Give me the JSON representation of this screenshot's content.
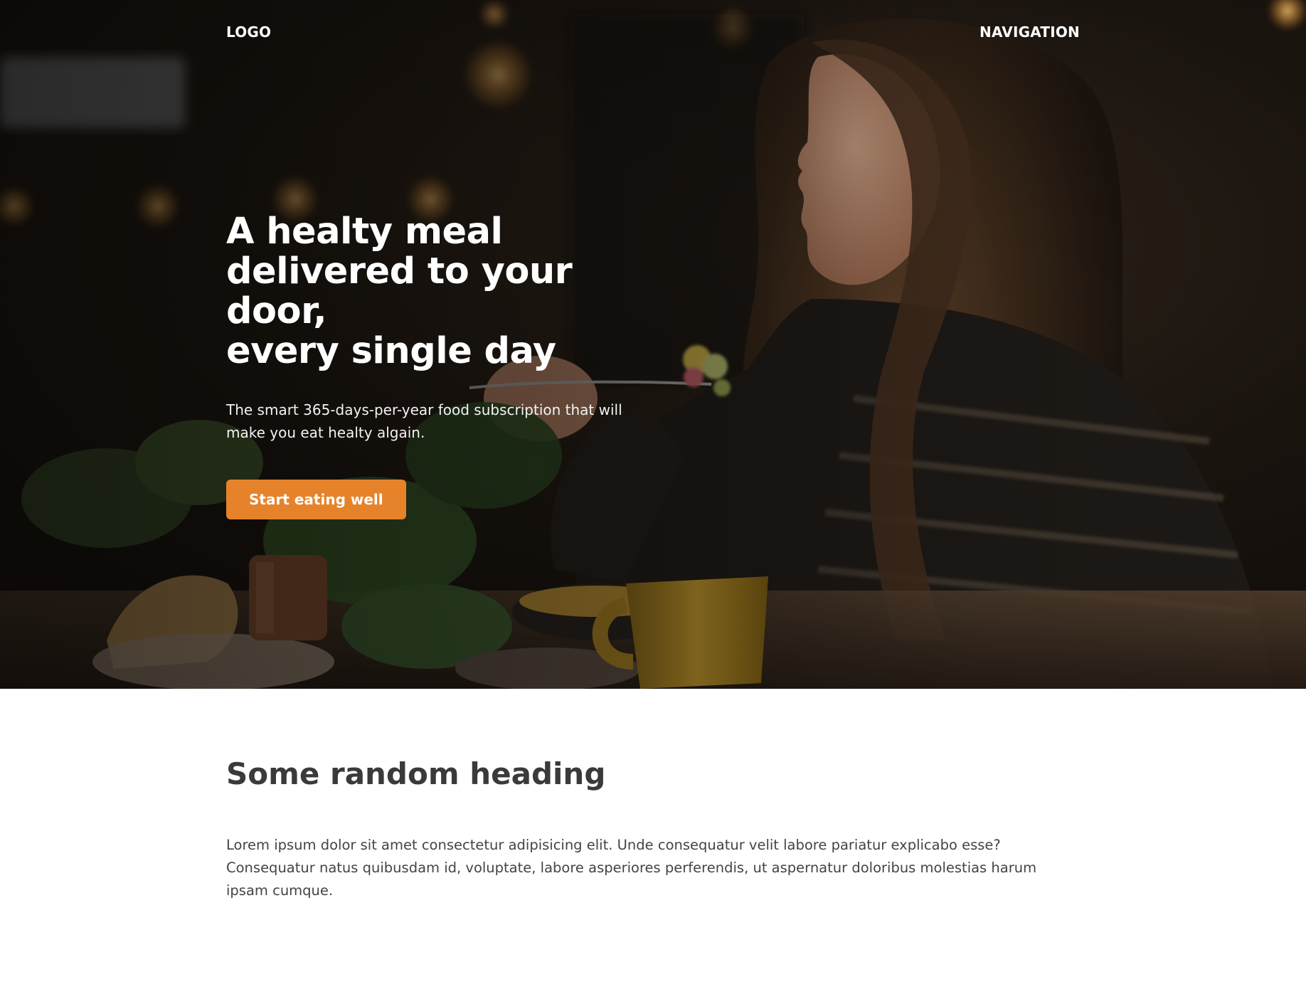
{
  "header": {
    "logo": "LOGO",
    "navigation": "NAVIGATION"
  },
  "hero": {
    "title_lines": [
      "A healty meal",
      "delivered to your door,",
      "every single day"
    ],
    "subtitle_lines": [
      "The smart 365-days-per-year food subscription that will",
      "make you eat healty algain."
    ],
    "cta_label": "Start eating well"
  },
  "section": {
    "heading": "Some random heading",
    "body": "Lorem ipsum dolor sit amet consectetur adipisicing elit. Unde consequatur velit labore pariatur explicabo esse? Consequatur natus quibusdam id, voluptate, labore asperiores perferendis, ut aspernatur doloribus molestias harum ipsam cumque."
  },
  "colors": {
    "accent": "#e6832a",
    "text_dark": "#3a3a3a",
    "hero_text": "#ffffff"
  }
}
